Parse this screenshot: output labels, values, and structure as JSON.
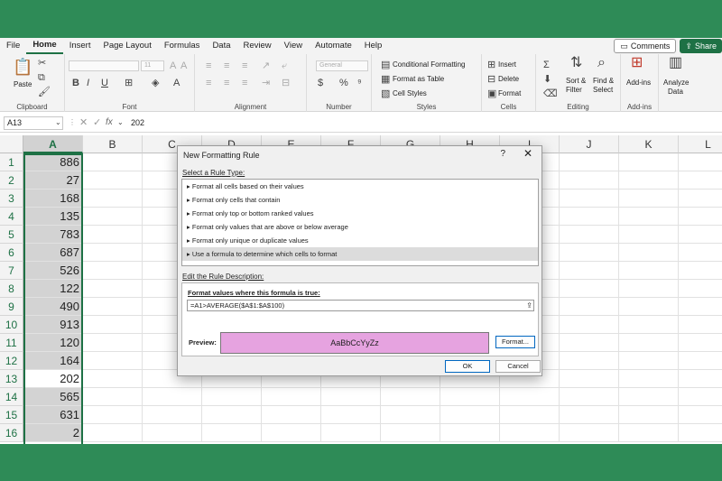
{
  "tabs": [
    "File",
    "Home",
    "Insert",
    "Page Layout",
    "Formulas",
    "Data",
    "Review",
    "View",
    "Automate",
    "Help"
  ],
  "active_tab": "Home",
  "comments_label": "Comments",
  "share_label": "Share",
  "ribbon": {
    "clipboard": {
      "label": "Clipboard",
      "paste": "Paste"
    },
    "font": {
      "label": "Font",
      "size": "11"
    },
    "alignment": {
      "label": "Alignment"
    },
    "number": {
      "label": "Number",
      "format": "General"
    },
    "styles": {
      "label": "Styles",
      "conditional": "Conditional Formatting",
      "table": "Format as Table",
      "cell": "Cell Styles"
    },
    "cells": {
      "label": "Cells",
      "insert": "Insert",
      "delete": "Delete",
      "format": "Format"
    },
    "editing": {
      "label": "Editing",
      "sort1": "Sort &",
      "sort2": "Filter",
      "find1": "Find &",
      "find2": "Select"
    },
    "addins": {
      "label": "Add-ins",
      "btn": "Add-ins"
    },
    "analyze": {
      "line1": "Analyze",
      "line2": "Data"
    }
  },
  "formula_bar": {
    "name_box": "A13",
    "fx": "fx",
    "value": "202"
  },
  "columns": [
    "A",
    "B",
    "C",
    "D",
    "E",
    "F",
    "G",
    "H",
    "I",
    "J",
    "K",
    "L"
  ],
  "rows": [
    {
      "n": "1",
      "a": "886"
    },
    {
      "n": "2",
      "a": "27"
    },
    {
      "n": "3",
      "a": "168"
    },
    {
      "n": "4",
      "a": "135"
    },
    {
      "n": "5",
      "a": "783"
    },
    {
      "n": "6",
      "a": "687"
    },
    {
      "n": "7",
      "a": "526"
    },
    {
      "n": "8",
      "a": "122"
    },
    {
      "n": "9",
      "a": "490"
    },
    {
      "n": "10",
      "a": "913"
    },
    {
      "n": "11",
      "a": "120"
    },
    {
      "n": "12",
      "a": "164"
    },
    {
      "n": "13",
      "a": "202"
    },
    {
      "n": "14",
      "a": "565"
    },
    {
      "n": "15",
      "a": "631"
    },
    {
      "n": "16",
      "a": "2"
    }
  ],
  "active_row": "13",
  "dialog": {
    "title": "New Formatting Rule",
    "help": "?",
    "close": "✕",
    "select_type_label": "Select a Rule Type:",
    "rule_types": [
      "Format all cells based on their values",
      "Format only cells that contain",
      "Format only top or bottom ranked values",
      "Format only values that are above or below average",
      "Format only unique or duplicate values",
      "Use a formula to determine which cells to format"
    ],
    "selected_rule": 5,
    "edit_label": "Edit the Rule Description:",
    "formula_label": "Format values where this formula is true:",
    "formula_value": "=A1>AVERAGE($A$1:$A$100)",
    "preview_label": "Preview:",
    "preview_text": "AaBbCcYyZz",
    "preview_color": "#e6a3e0",
    "format_button": "Format...",
    "ok_button": "OK",
    "cancel_button": "Cancel"
  }
}
